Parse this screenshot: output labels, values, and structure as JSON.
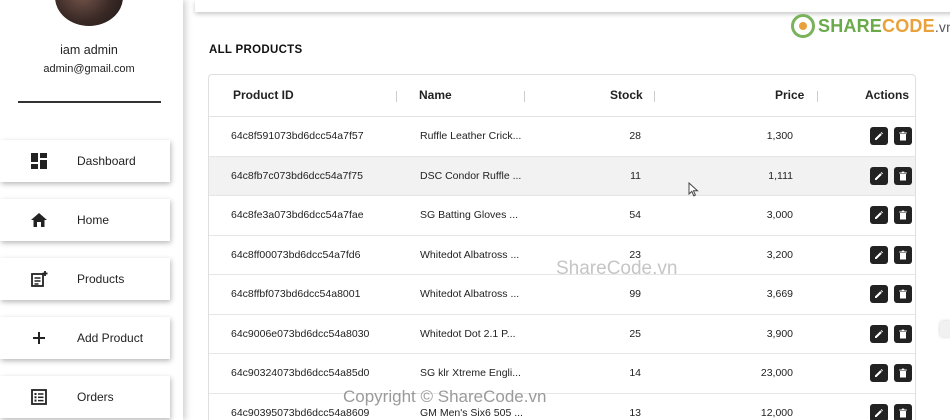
{
  "user": {
    "name": "iam admin",
    "email": "admin@gmail.com"
  },
  "sidebar": {
    "items": [
      {
        "label": "Dashboard",
        "icon": "dashboard-icon"
      },
      {
        "label": "Home",
        "icon": "home-icon"
      },
      {
        "label": "Products",
        "icon": "product-add-icon"
      },
      {
        "label": "Add Product",
        "icon": "plus-icon"
      },
      {
        "label": "Orders",
        "icon": "list-icon"
      }
    ]
  },
  "logo": {
    "share": "SHARE",
    "code": "CODE",
    "vn": ".vn"
  },
  "page": {
    "title": "ALL PRODUCTS"
  },
  "table": {
    "columns": [
      "Product ID",
      "Name",
      "Stock",
      "Price",
      "Actions"
    ],
    "rows": [
      {
        "id": "64c8f591073bd6dcc54a7f57",
        "name": "Ruffle Leather Crick...",
        "stock": "28",
        "price": "1,300"
      },
      {
        "id": "64c8fb7c073bd6dcc54a7f75",
        "name": "DSC Condor Ruffle ...",
        "stock": "11",
        "price": "1,111"
      },
      {
        "id": "64c8fe3a073bd6dcc54a7fae",
        "name": "SG Batting Gloves ...",
        "stock": "54",
        "price": "3,000"
      },
      {
        "id": "64c8ff00073bd6dcc54a7fd6",
        "name": "Whitedot Albatross ...",
        "stock": "23",
        "price": "3,200"
      },
      {
        "id": "64c8ffbf073bd6dcc54a8001",
        "name": "Whitedot Albatross ...",
        "stock": "99",
        "price": "3,669"
      },
      {
        "id": "64c9006e073bd6dcc54a8030",
        "name": "Whitedot Dot 2.1 P...",
        "stock": "25",
        "price": "3,900"
      },
      {
        "id": "64c90324073bd6dcc54a85d0",
        "name": "SG klr Xtreme Engli...",
        "stock": "14",
        "price": "23,000"
      },
      {
        "id": "64c90395073bd6dcc54a8609",
        "name": "GM Men's Six6 505 ...",
        "stock": "13",
        "price": "12,000"
      }
    ]
  },
  "watermarks": {
    "center": "ShareCode.vn",
    "bottom": "Copyright © ShareCode.vn"
  },
  "colors": {
    "action_button": "#222222",
    "logo_green": "#6aaa4a",
    "logo_orange": "#e9a23b"
  }
}
